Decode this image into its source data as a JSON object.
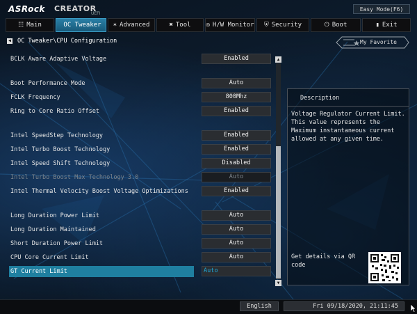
{
  "header": {
    "brand": "ASRock",
    "product": "CREATOR",
    "subtitle": "UEFI",
    "easy_mode": "Easy Mode(F6)"
  },
  "tabs": [
    {
      "label": "Main",
      "icon": "grid-icon",
      "glyph": "☷"
    },
    {
      "label": "OC Tweaker",
      "icon": "rocket-icon",
      "glyph": ""
    },
    {
      "label": "Advanced",
      "icon": "star-icon",
      "glyph": "✶"
    },
    {
      "label": "Tool",
      "icon": "tools-icon",
      "glyph": "✖"
    },
    {
      "label": "H/W Monitor",
      "icon": "monitor-icon",
      "glyph": "◎"
    },
    {
      "label": "Security",
      "icon": "shield-icon",
      "glyph": "⛨"
    },
    {
      "label": "Boot",
      "icon": "power-icon",
      "glyph": "⏻"
    },
    {
      "label": "Exit",
      "icon": "exit-icon",
      "glyph": "▮"
    }
  ],
  "active_tab": "OC Tweaker",
  "breadcrumb": "OC Tweaker\\CPU Configuration",
  "favorite": "My Favorite",
  "settings": [
    {
      "name": "BCLK Aware Adaptive Voltage",
      "value": "Enabled"
    },
    {
      "name": "Boot Performance Mode",
      "value": "Auto"
    },
    {
      "name": "FCLK Frequency",
      "value": "800Mhz"
    },
    {
      "name": "Ring to Core Ratio Offset",
      "value": "Enabled"
    },
    {
      "name": "Intel SpeedStep Technology",
      "value": "Enabled"
    },
    {
      "name": "Intel Turbo Boost Technology",
      "value": "Enabled"
    },
    {
      "name": "Intel Speed Shift Technology",
      "value": "Disabled"
    },
    {
      "name": "Intel Turbo Boost Max Technology 3.0",
      "value": "Auto"
    },
    {
      "name": "Intel Thermal Velocity Boost Voltage Optimizations",
      "value": "Enabled"
    },
    {
      "name": "Long Duration Power Limit",
      "value": "Auto"
    },
    {
      "name": "Long Duration Maintained",
      "value": "Auto"
    },
    {
      "name": "Short Duration Power Limit",
      "value": "Auto"
    },
    {
      "name": "CPU Core Current Limit",
      "value": "Auto"
    },
    {
      "name": "GT Current Limit",
      "value": "Auto"
    }
  ],
  "description": {
    "title": "Description",
    "text": "Voltage Regulator Current Limit. This value represents the Maximum instantaneous current allowed at any given time.",
    "qr_text": "Get details via QR code"
  },
  "footer": {
    "language": "English",
    "datetime": "Fri 09/18/2020, 21:11:45"
  },
  "colors": {
    "accent": "#1f7fa0",
    "active_tab": "#2a7fa6",
    "background": "#0d1d2f"
  }
}
